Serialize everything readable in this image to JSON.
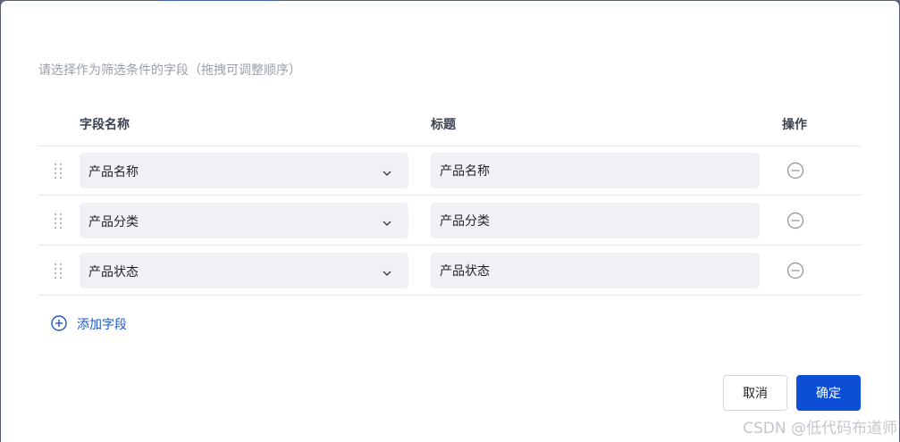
{
  "dialog": {
    "hint": "请选择作为筛选条件的字段（拖拽可调整顺序）",
    "columns": {
      "field_name": "字段名称",
      "title": "标题",
      "action": "操作"
    },
    "rows": [
      {
        "field": "产品名称",
        "title": "产品名称"
      },
      {
        "field": "产品分类",
        "title": "产品分类"
      },
      {
        "field": "产品状态",
        "title": "产品状态"
      }
    ],
    "add_field_label": "添加字段",
    "cancel_label": "取消",
    "confirm_label": "确定"
  },
  "icons": {
    "drag": "drag-handle-icon",
    "chevron": "chevron-down-icon",
    "remove": "minus-circle-icon",
    "add": "plus-circle-icon"
  },
  "colors": {
    "primary": "#0d4fd4",
    "link": "#1e57c8",
    "field_bg": "#f0f1f4",
    "hint_text": "#9aa0aa"
  },
  "watermark": "CSDN @低代码布道师"
}
